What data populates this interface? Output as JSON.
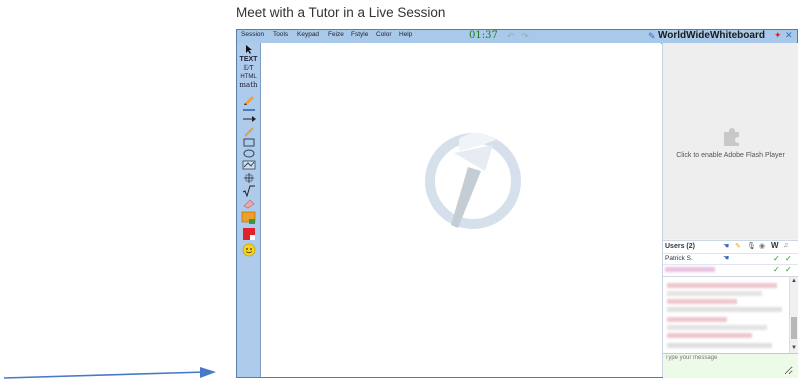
{
  "page": {
    "heading": "Meet with a Tutor in a Live Session"
  },
  "menubar": {
    "items": [
      "Session",
      "Tools",
      "Keypad",
      "Feize",
      "Fstyle",
      "Color",
      "Help"
    ],
    "timer": "01:37",
    "brand": "WorldWideWhiteboard"
  },
  "toolbar": {
    "tools": [
      {
        "label": "",
        "icon": "pointer-icon"
      },
      {
        "label": "TEXT",
        "icon": ""
      },
      {
        "label": "𝔼⁄T",
        "icon": ""
      },
      {
        "label": "HTML",
        "icon": ""
      },
      {
        "label": "math",
        "icon": ""
      },
      {
        "label": "",
        "icon": "pencil-icon"
      },
      {
        "label": "",
        "icon": "line-icon"
      },
      {
        "label": "",
        "icon": "arrow-icon"
      },
      {
        "label": "",
        "icon": "pen-icon"
      },
      {
        "label": "",
        "icon": "rectangle-icon"
      },
      {
        "label": "",
        "icon": "ellipse-icon"
      },
      {
        "label": "",
        "icon": "graph-icon"
      },
      {
        "label": "",
        "icon": "axes-icon"
      },
      {
        "label": "",
        "icon": "sqrt-icon"
      },
      {
        "label": "",
        "icon": "eraser-icon"
      },
      {
        "label": "",
        "icon": "image-icon"
      },
      {
        "label": "",
        "icon": "color-icon"
      },
      {
        "label": "",
        "icon": "smiley-icon"
      }
    ]
  },
  "flash": {
    "text": "Click to enable Adobe Flash Player"
  },
  "users": {
    "header": "Users (2)",
    "rows": [
      {
        "name": "Patrick S."
      },
      {
        "name": ""
      }
    ]
  },
  "chat": {
    "placeholder": "Type your message"
  },
  "colors": {
    "accent": "#a9c9ea",
    "arrow": "#4a78c8"
  }
}
